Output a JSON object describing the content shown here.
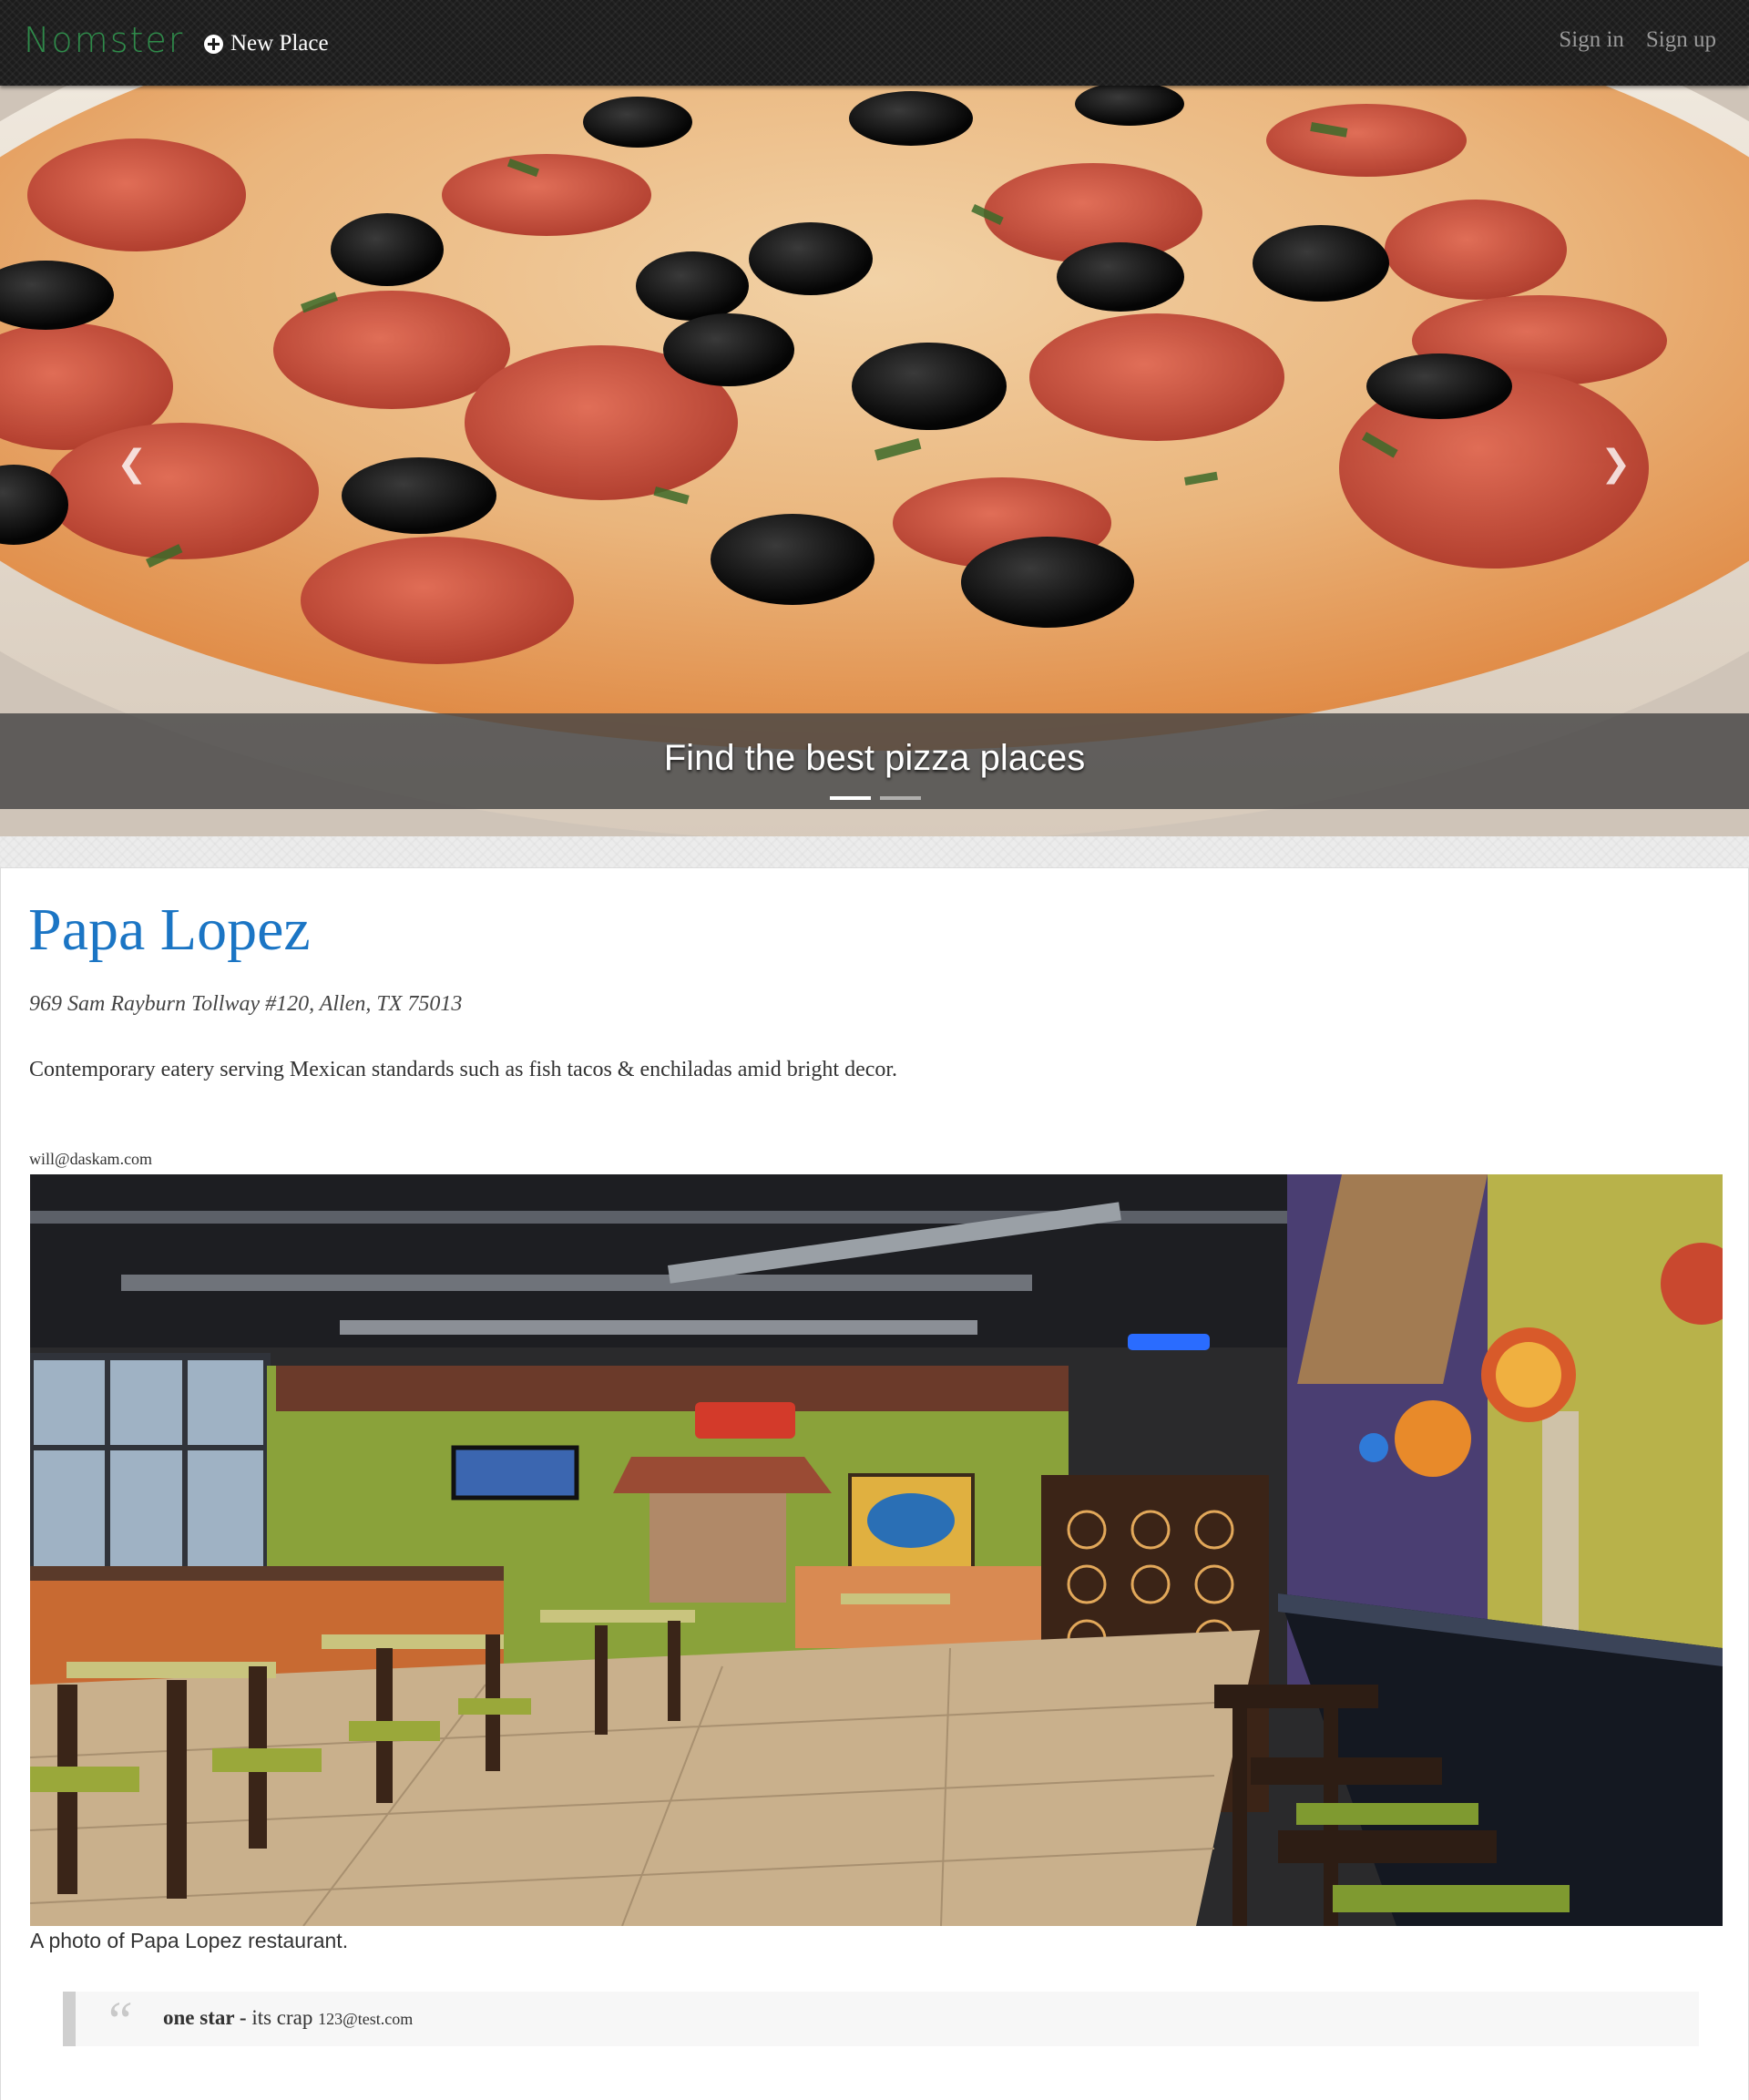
{
  "navbar": {
    "brand": "Nomster",
    "new_place_label": "New Place",
    "new_place_icon": "plus-circle-icon",
    "sign_in_label": "Sign in",
    "sign_up_label": "Sign up"
  },
  "carousel": {
    "caption": "Find the best pizza places",
    "slide_count": 2,
    "active_slide": 1,
    "prev_icon": "chevron-left-icon",
    "next_icon": "chevron-right-icon"
  },
  "place": {
    "name": "Papa Lopez",
    "address": "969 Sam Rayburn Tollway #120, Allen, TX 75013",
    "description": "Contemporary eatery serving Mexican standards such as fish tacos & enchiladas amid bright decor.",
    "owner_email": "will@daskam.com",
    "photo_caption": "A photo of Papa Lopez restaurant."
  },
  "reviews": [
    {
      "rating": "one star",
      "separator": " - ",
      "comment": "its crap",
      "author": "123@test.com"
    }
  ],
  "colors": {
    "navbar_bg": "#1c1c1c",
    "brand": "#2f8a4a",
    "place_name": "#1b75c4"
  }
}
